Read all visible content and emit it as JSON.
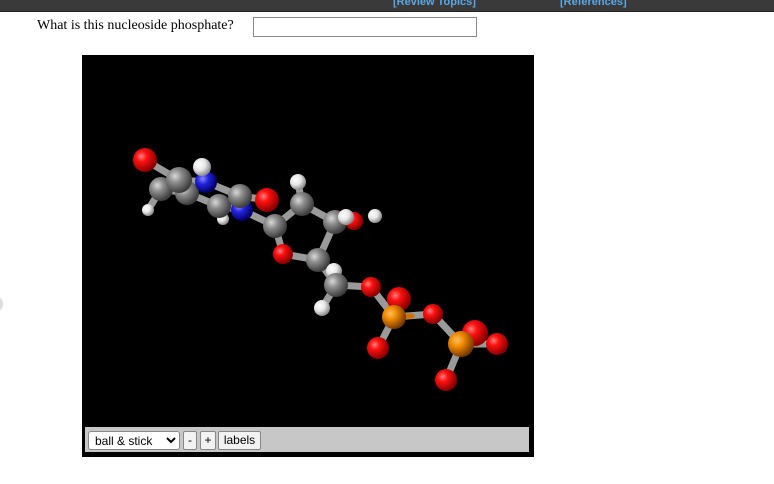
{
  "header": {
    "review_topics": "[Review Topics]",
    "references": "[References]"
  },
  "question": {
    "text": "What is this nucleoside phosphate?",
    "answer_value": ""
  },
  "viewer": {
    "style_options": [
      "ball & stick"
    ],
    "selected_style": "ball & stick",
    "zoom_out_label": "-",
    "zoom_in_label": "+",
    "labels_button": "labels"
  }
}
